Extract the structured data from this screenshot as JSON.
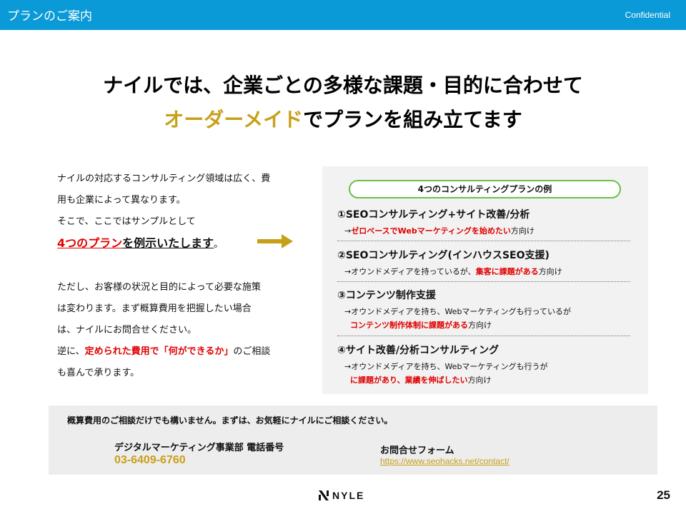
{
  "header": {
    "title": "プランのご案内",
    "confidential": "Confidential"
  },
  "headline": {
    "line1": "ナイルでは、企業ごとの多様な課題・目的に合わせて",
    "line2_highlight": "オーダーメイド",
    "line2_rest": "でプランを組み立てます"
  },
  "intro": {
    "line1": "ナイルの対応するコンサルティング領域は広く、費",
    "line2": "用も企業によって異なります。",
    "line3": "そこで、ここではサンプルとして",
    "line4_red": "4つのプラン",
    "line4_rest": "を例示いたします",
    "line4_end": "。",
    "line5": "ただし、お客様の状況と目的によって必要な施策",
    "line6": "は変わります。まず概算費用を把握したい場合",
    "line7": "は、ナイルにお問合せください。",
    "line8_a": "逆に、",
    "line8_red": "定められた費用で「何ができるか」",
    "line8_b": "のご相談",
    "line9": "も喜んで承ります。"
  },
  "plans": {
    "heading": "4つのコンサルティングプランの例",
    "p1": {
      "title": "①SEOコンサルティング+サイト改善/分析",
      "arrow": "→",
      "red": "ゼロベースでWebマーケティングを始めたい",
      "suffix": "方向け"
    },
    "p2": {
      "title": "②SEOコンサルティング(インハウスSEO支援)",
      "prefix": "→オウンドメディアを持っているが、",
      "red": "集客に課題がある",
      "suffix": "方向け"
    },
    "p3": {
      "title": "③コンテンツ制作支援",
      "line1": "→オウンドメディアを持ち、Webマーケティングも行っているが",
      "red": "コンテンツ制作体制に課題がある",
      "suffix": "方向け"
    },
    "p4": {
      "title": "④サイト改善/分析コンサルティング",
      "line1": "→オウンドメディアを持ち、Webマーケティングも行うが",
      "red": "に課題があり、業績を伸ばしたい",
      "suffix": "方向け"
    }
  },
  "contact": {
    "note": "概算費用のご相談だけでも構いません。まずは、お気軽にナイルにご相談ください。",
    "dept": "デジタルマーケティング事業部 電話番号",
    "phone": "03-6409-6760",
    "form_label": "お問合せフォーム",
    "form_url": "https://www.seohacks.net/contact/"
  },
  "footer": {
    "logo": "NYLE",
    "page": "25"
  },
  "colors": {
    "header": "#0a9ad7",
    "gold": "#c8a018",
    "red": "#e00000",
    "green": "#6cc04a"
  }
}
